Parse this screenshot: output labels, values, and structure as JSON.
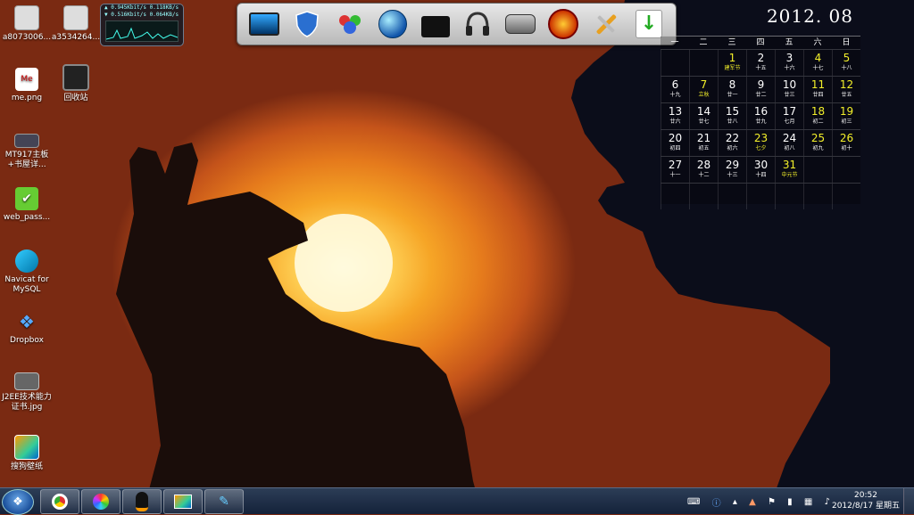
{
  "desktop_icons": [
    {
      "label": "a8073006...",
      "icon": "file-icon"
    },
    {
      "label": "a3534264...",
      "icon": "file-icon"
    },
    {
      "label": "me.png",
      "icon": "image-file-icon"
    },
    {
      "label": "回收站",
      "icon": "recycle-bin-icon"
    },
    {
      "label": "MT917主板+书屋详...",
      "icon": "motherboard-icon"
    },
    {
      "label": "web_pass...",
      "icon": "frog-icon"
    },
    {
      "label": "Navicat for MySQL",
      "icon": "navicat-icon"
    },
    {
      "label": "Dropbox",
      "icon": "dropbox-icon"
    },
    {
      "label": "J2EE技术能力证书.jpg",
      "icon": "image-file-icon"
    },
    {
      "label": "搜狗壁纸",
      "icon": "sogou-wallpaper-icon"
    }
  ],
  "net_meter": {
    "download_kbits": "0.945Kbit/s",
    "download_kb": "0.118KB/s",
    "upload_kbits": "0.516Kbit/s",
    "upload_kb": "0.064KB/s"
  },
  "dock_apps": [
    "monitor-icon",
    "shield-icon",
    "people-icon",
    "globe-icon",
    "briefcase-icon",
    "headphones-icon",
    "camcorder-icon",
    "warrior-icon",
    "tools-icon",
    "download-icon"
  ],
  "calendar": {
    "title": "2012. 08",
    "weekdays": [
      "一",
      "二",
      "三",
      "四",
      "五",
      "六",
      "日"
    ],
    "weeks": [
      [
        {
          "d": "",
          "l": ""
        },
        {
          "d": "",
          "l": ""
        },
        {
          "d": "1",
          "l": "建军节",
          "t": "fest"
        },
        {
          "d": "2",
          "l": "十五"
        },
        {
          "d": "3",
          "l": "十六"
        },
        {
          "d": "4",
          "l": "十七",
          "t": "we"
        },
        {
          "d": "5",
          "l": "十八",
          "t": "we"
        }
      ],
      [
        {
          "d": "6",
          "l": "十九"
        },
        {
          "d": "7",
          "l": "立秋",
          "t": "fest"
        },
        {
          "d": "8",
          "l": "廿一"
        },
        {
          "d": "9",
          "l": "廿二"
        },
        {
          "d": "10",
          "l": "廿三"
        },
        {
          "d": "11",
          "l": "廿四",
          "t": "we"
        },
        {
          "d": "12",
          "l": "廿五",
          "t": "we"
        }
      ],
      [
        {
          "d": "13",
          "l": "廿六"
        },
        {
          "d": "14",
          "l": "廿七"
        },
        {
          "d": "15",
          "l": "廿八"
        },
        {
          "d": "16",
          "l": "廿九"
        },
        {
          "d": "17",
          "l": "七月"
        },
        {
          "d": "18",
          "l": "初二",
          "t": "we"
        },
        {
          "d": "19",
          "l": "初三",
          "t": "we"
        }
      ],
      [
        {
          "d": "20",
          "l": "初四"
        },
        {
          "d": "21",
          "l": "初五"
        },
        {
          "d": "22",
          "l": "初六"
        },
        {
          "d": "23",
          "l": "七夕",
          "t": "fest"
        },
        {
          "d": "24",
          "l": "初八"
        },
        {
          "d": "25",
          "l": "初九",
          "t": "we"
        },
        {
          "d": "26",
          "l": "初十",
          "t": "we"
        }
      ],
      [
        {
          "d": "27",
          "l": "十一"
        },
        {
          "d": "28",
          "l": "十二"
        },
        {
          "d": "29",
          "l": "十三"
        },
        {
          "d": "30",
          "l": "十四"
        },
        {
          "d": "31",
          "l": "中元节",
          "t": "fest"
        },
        {
          "d": "",
          "l": ""
        },
        {
          "d": "",
          "l": ""
        }
      ],
      [
        {
          "d": "",
          "l": ""
        },
        {
          "d": "",
          "l": ""
        },
        {
          "d": "",
          "l": ""
        },
        {
          "d": "",
          "l": ""
        },
        {
          "d": "",
          "l": ""
        },
        {
          "d": "",
          "l": ""
        },
        {
          "d": "",
          "l": ""
        }
      ]
    ]
  },
  "taskbar": {
    "pinned": [
      "chrome-icon",
      "color-wheel-icon",
      "qq-penguin-icon",
      "wallpaper-app-icon",
      "pen-tool-icon"
    ],
    "tray": [
      "keyboard-icon",
      "help-icon",
      "arrow-icon",
      "shield-icon",
      "flag-icon",
      "battery-icon",
      "network-icon",
      "volume-icon"
    ],
    "time": "20:52",
    "date": "2012/8/17 星期五"
  }
}
